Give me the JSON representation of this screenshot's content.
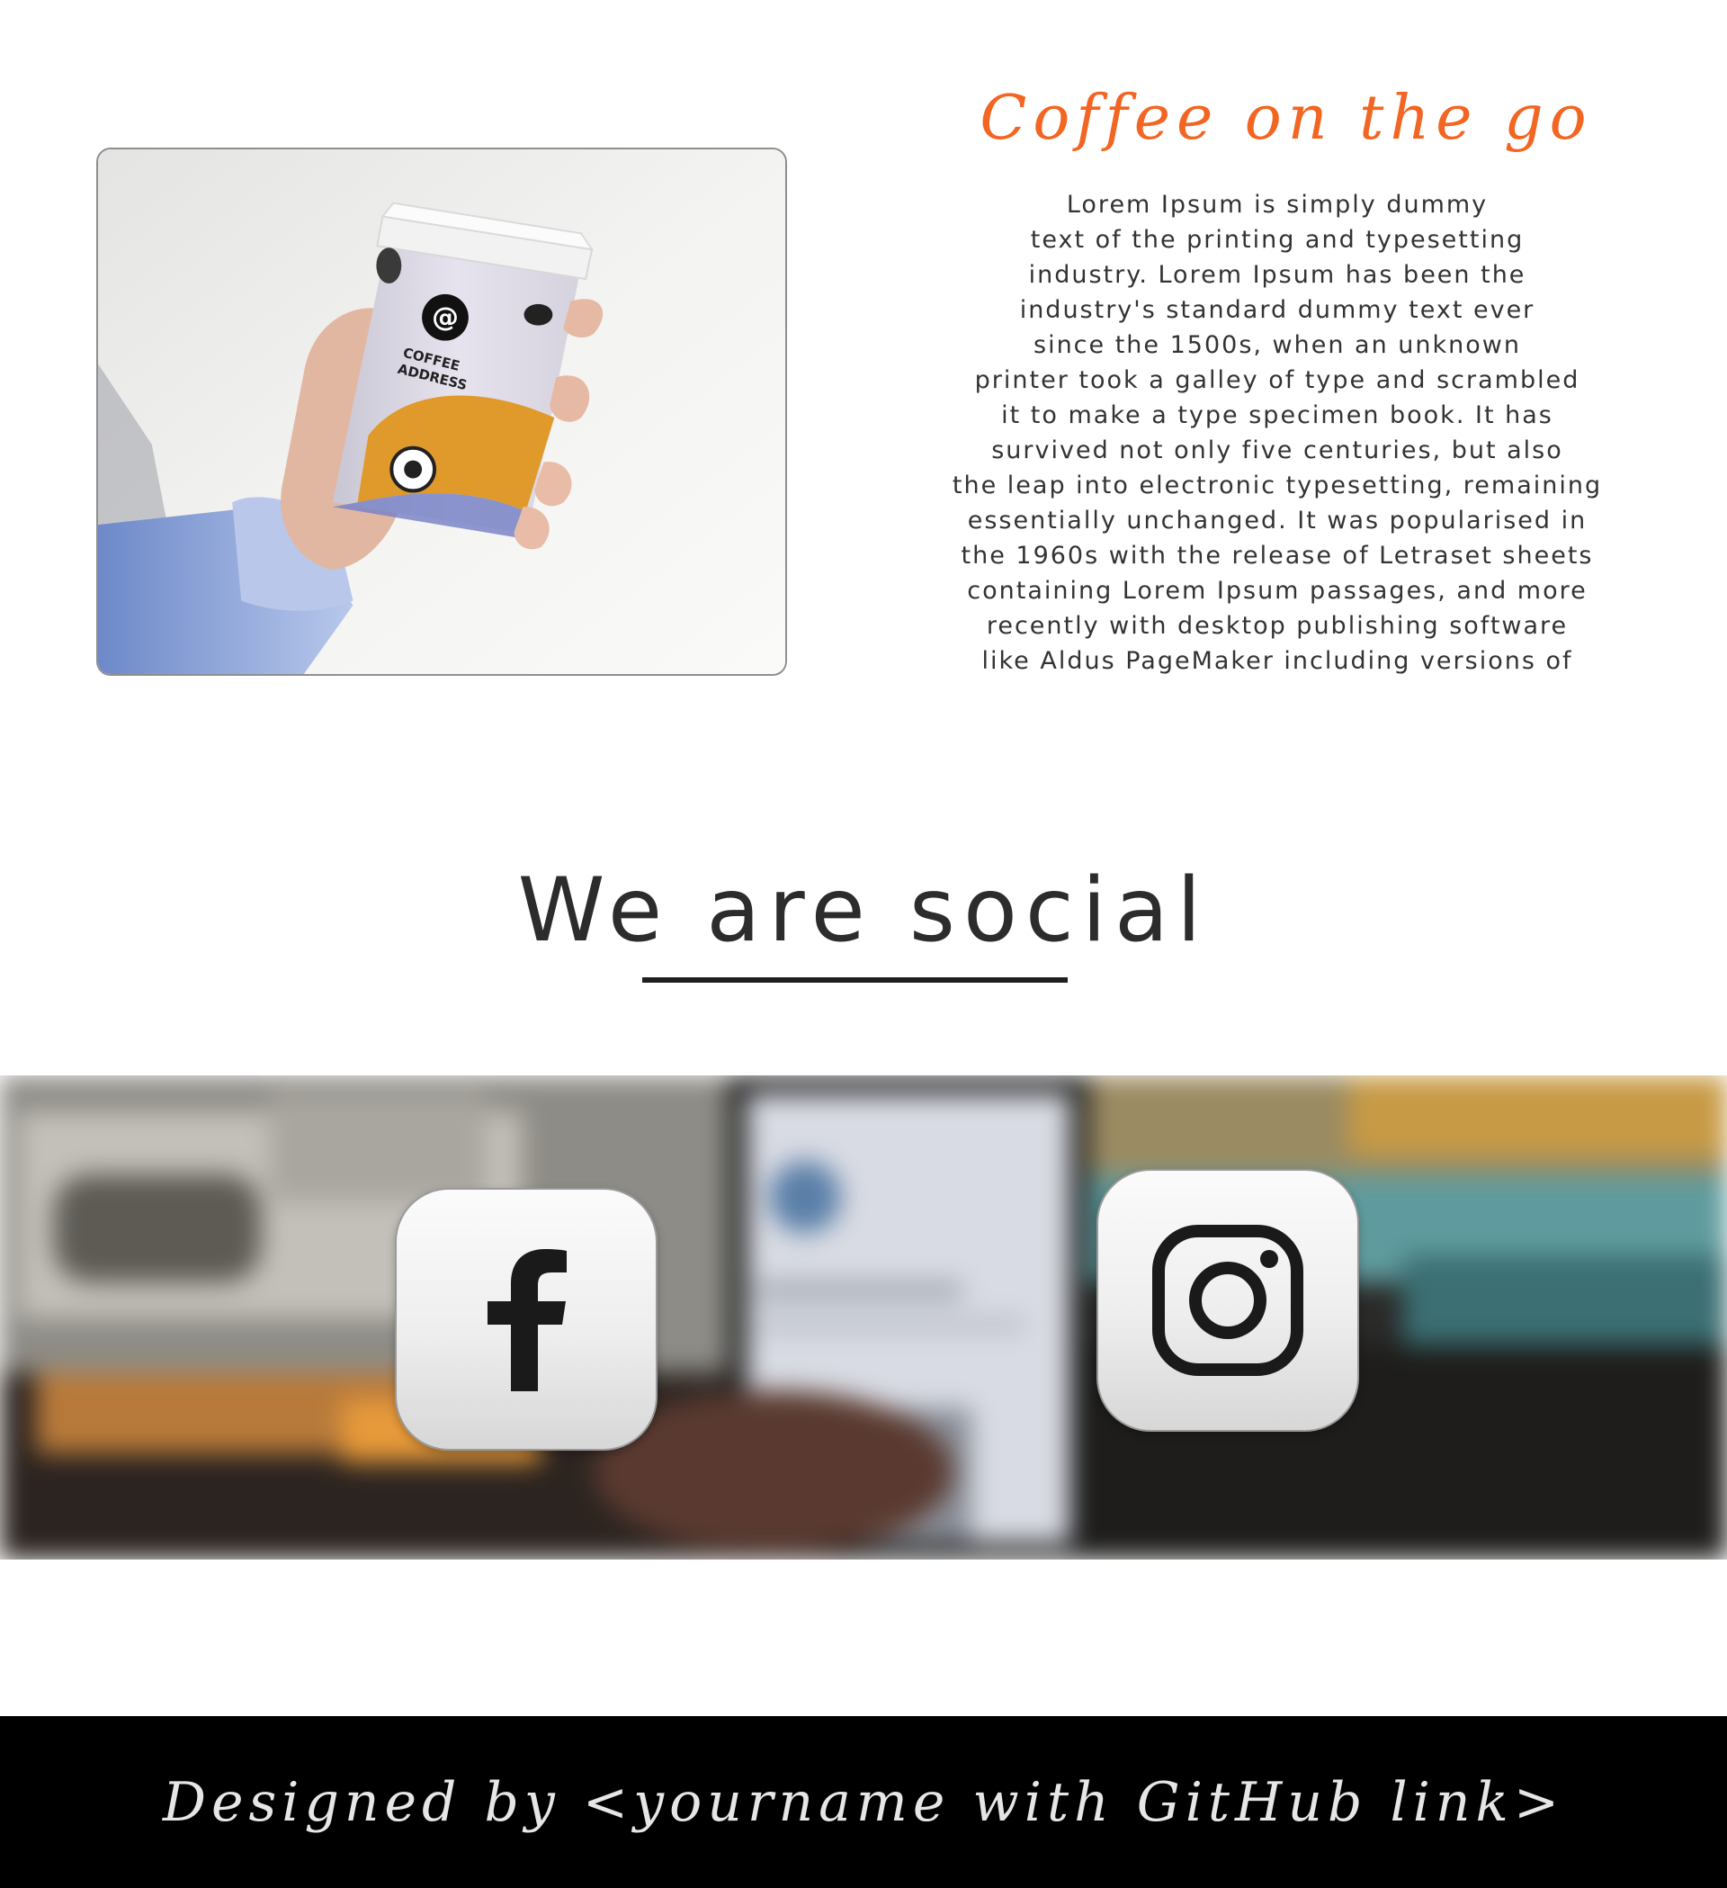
{
  "coffee": {
    "title": "Coffee on the go",
    "image_alt_brand": "COFFEE ADDRESS",
    "lines": [
      "Lorem Ipsum is simply dummy",
      "text of the printing and typesetting",
      "industry. Lorem Ipsum has been the",
      "industry's standard dummy text ever",
      "since the 1500s, when an unknown",
      "printer took a galley of type and scrambled",
      "it to make a type specimen book. It has",
      "survived not only five centuries, but also",
      "the leap into electronic typesetting, remaining",
      "essentially unchanged. It was popularised in",
      "the 1960s with the release of Letraset sheets",
      "containing Lorem Ipsum passages, and more",
      "recently with desktop publishing software",
      "like Aldus PageMaker including versions of"
    ]
  },
  "social": {
    "heading": "We are social",
    "buttons": [
      {
        "icon": "facebook-icon"
      },
      {
        "icon": "instagram-icon"
      }
    ]
  },
  "footer": {
    "text": "Designed by <yourname with GitHub link>"
  },
  "colors": {
    "accent": "#f26522",
    "footer_bg": "#000000",
    "footer_text": "#e6e6e6"
  }
}
